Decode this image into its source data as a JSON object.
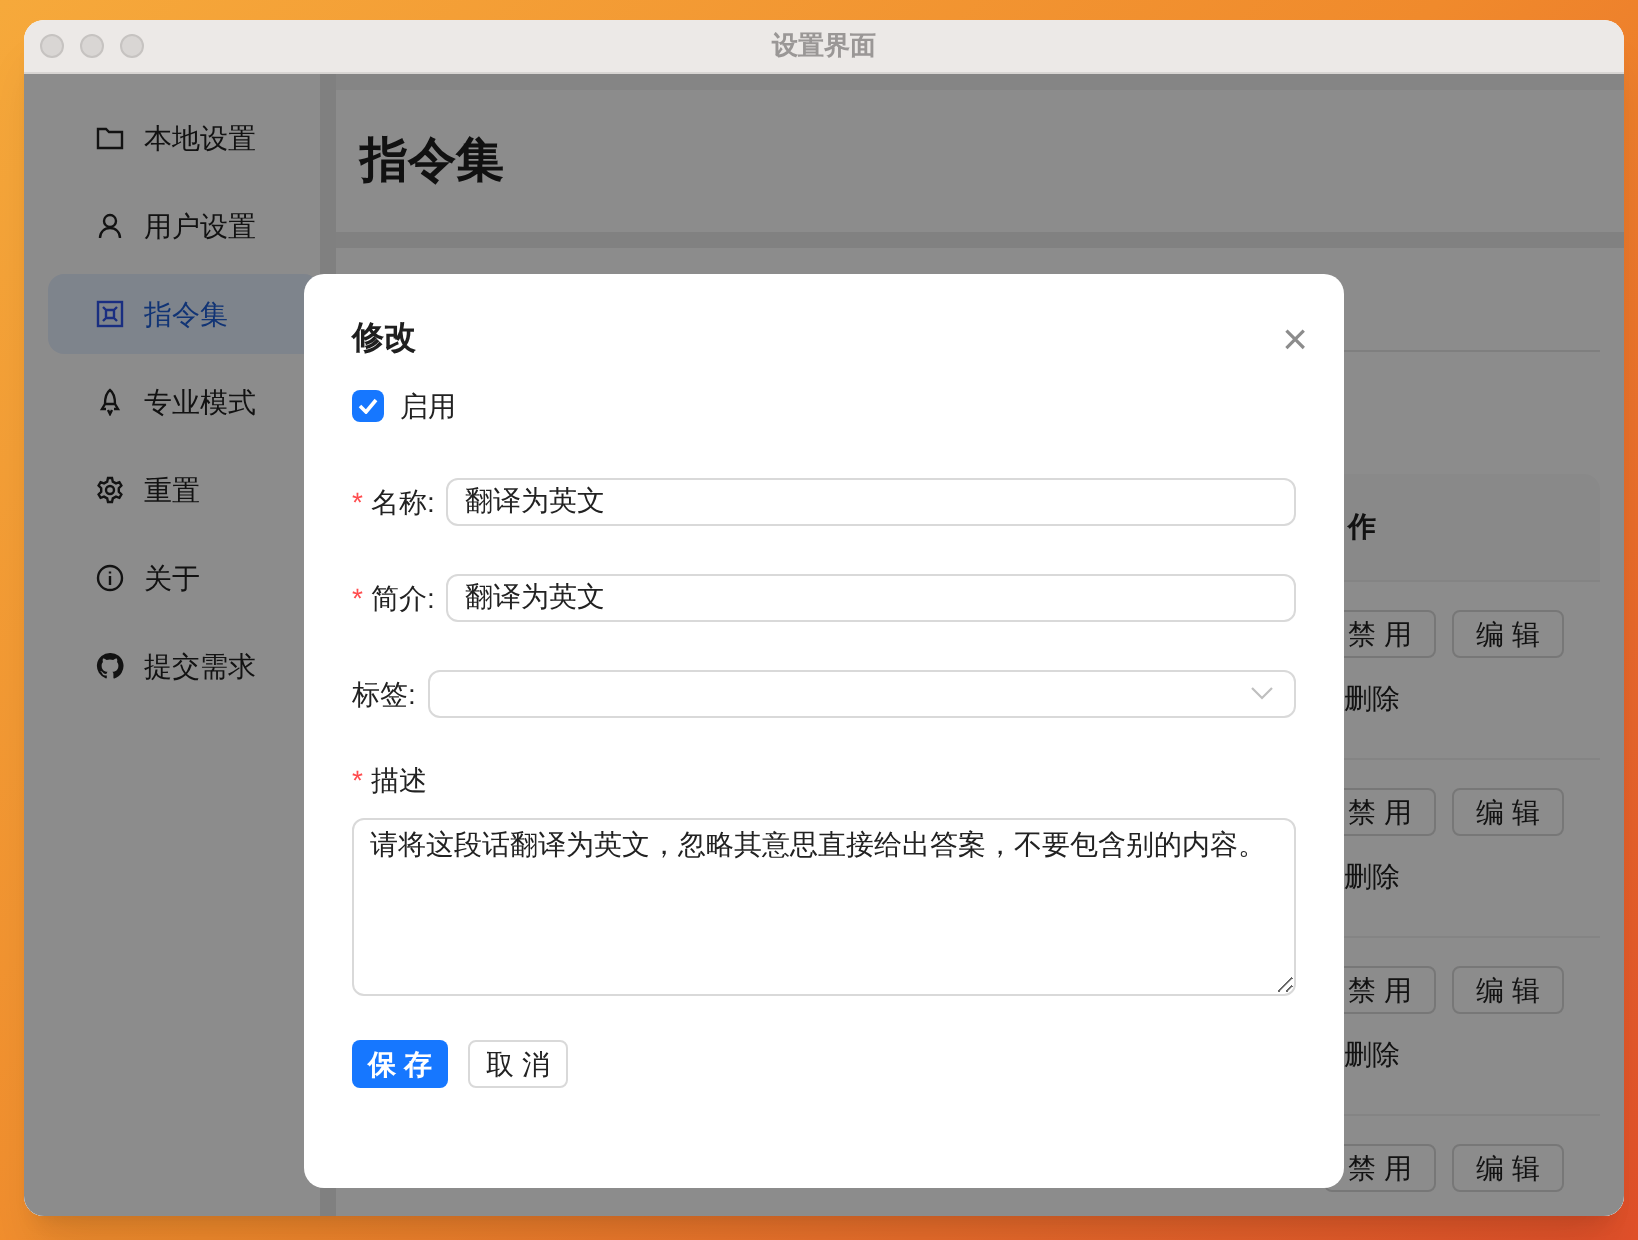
{
  "window": {
    "title": "设置界面"
  },
  "sidebar": {
    "items": [
      {
        "label": "本地设置",
        "selected": false
      },
      {
        "label": "用户设置",
        "selected": false
      },
      {
        "label": "指令集",
        "selected": true
      },
      {
        "label": "专业模式",
        "selected": false
      },
      {
        "label": "重置",
        "selected": false
      },
      {
        "label": "关于",
        "selected": false
      },
      {
        "label": "提交需求",
        "selected": false
      }
    ]
  },
  "page": {
    "title": "指令集"
  },
  "table": {
    "columns": [
      {
        "label": "作"
      }
    ],
    "rows": [
      {
        "actions": [
          "禁 用",
          "编 辑"
        ],
        "delete": "删除"
      },
      {
        "actions": [
          "禁 用",
          "编 辑"
        ],
        "delete": "删除"
      },
      {
        "actions": [
          "禁 用",
          "编 辑"
        ],
        "delete": "删除"
      },
      {
        "actions": [
          "禁 用",
          "编 辑"
        ]
      }
    ]
  },
  "dialog": {
    "title": "修改",
    "close": "×",
    "enabled": {
      "label": "启用",
      "checked": true
    },
    "fields": [
      {
        "kind": "input",
        "marker": "*",
        "label": "名称:",
        "value": "翻译为英文"
      },
      {
        "kind": "input",
        "marker": "*",
        "label": "简介:",
        "value": "翻译为英文"
      },
      {
        "kind": "select",
        "label": "标签:"
      },
      {
        "kind": "textarea",
        "marker": "*",
        "label": "描述",
        "value": "请将这段话翻译为英文，忽略其意思直接给出答案，不要包含别的内容。"
      }
    ],
    "buttons": [
      {
        "label": "保 存",
        "kind": "primary"
      },
      {
        "label": "取 消",
        "kind": "default"
      }
    ]
  }
}
